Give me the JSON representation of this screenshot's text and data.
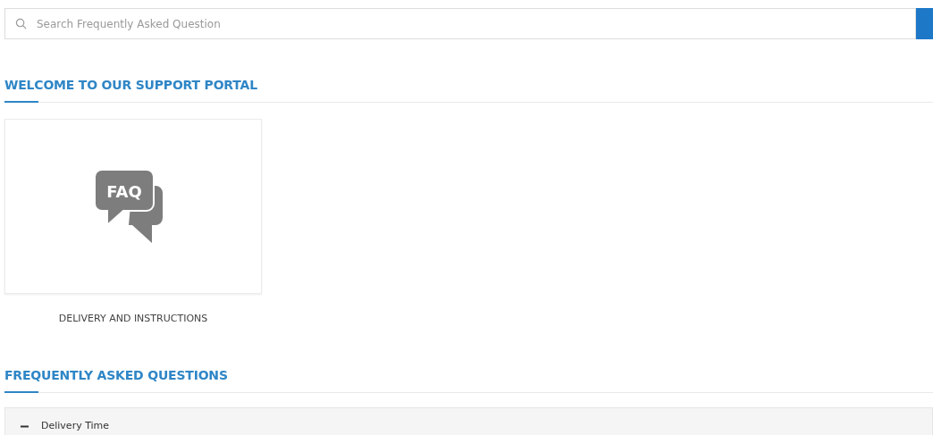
{
  "search": {
    "placeholder": "Search Frequently Asked Question"
  },
  "welcome": {
    "heading": "WELCOME TO OUR SUPPORT PORTAL",
    "categories": [
      {
        "icon_text": "FAQ",
        "label": "DELIVERY AND INSTRUCTIONS"
      }
    ]
  },
  "faq": {
    "heading": "FREQUENTLY ASKED QUESTIONS",
    "items": [
      {
        "question": "Delivery Time",
        "expanded": true
      }
    ]
  }
}
